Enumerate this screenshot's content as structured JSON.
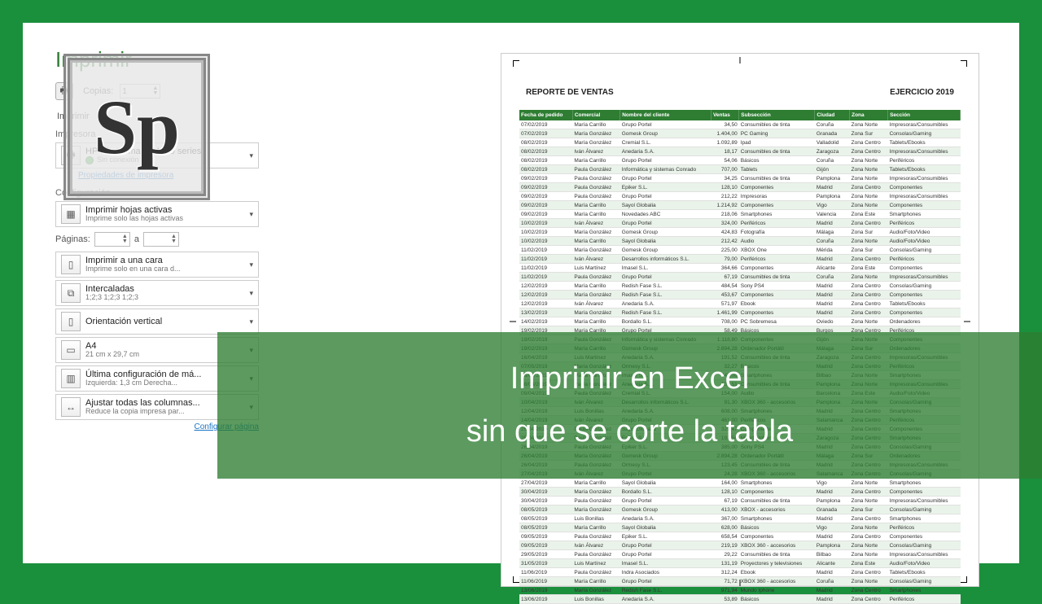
{
  "sidebar": {
    "title": "Imprimir",
    "copies_label": "Copias:",
    "copies_value": "1",
    "print_label": "Imprimir",
    "printer_section": "Impresora",
    "printer_name": "HP Photosmart C4400 series",
    "printer_status": "Sin conexión",
    "printer_props_link": "Propiedades de impresora",
    "config_section": "Configuración",
    "active_sheets": {
      "t1": "Imprimir hojas activas",
      "t2": "Imprime solo las hojas activas"
    },
    "pages_label": "Páginas:",
    "pages_to": "a",
    "one_side": {
      "t1": "Imprimir a una cara",
      "t2": "Imprime solo en una cara d..."
    },
    "collated": {
      "t1": "Intercaladas",
      "t2": "1;2;3   1;2;3   1;2;3"
    },
    "orientation": {
      "t1": "Orientación vertical",
      "t2": ""
    },
    "paper": {
      "t1": "A4",
      "t2": "21 cm x 29,7 cm"
    },
    "margins": {
      "t1": "Última configuración de má...",
      "t2": "Izquierda: 1,3 cm   Derecha..."
    },
    "scaling": {
      "t1": "Ajustar todas las columnas...",
      "t2": "Reduce la copia impresa par..."
    },
    "page_setup_link": "Configurar página"
  },
  "logo_text": "Sp",
  "overlay": {
    "line1": "Imprimir en Excel",
    "line2": "sin que se corte la tabla"
  },
  "report": {
    "title": "REPORTE DE VENTAS",
    "period": "EJERCICIO 2019",
    "columns": [
      "Fecha de pedido",
      "Comercial",
      "Nombre del cliente",
      "Ventas",
      "Subsección",
      "Ciudad",
      "Zona",
      "Sección"
    ],
    "rows": [
      [
        "07/02/2019",
        "María Carrillo",
        "Grupo Portel",
        "34,50",
        "Consumibles de tinta",
        "Coruña",
        "Zona Norte",
        "Impresoras/Consumibles"
      ],
      [
        "07/02/2019",
        "María González",
        "Gomesk Group",
        "1.404,00",
        "PC Gaming",
        "Granada",
        "Zona Sur",
        "Consolas/Gaming"
      ],
      [
        "08/02/2019",
        "María González",
        "Cremial S.L.",
        "1.092,89",
        "Ipad",
        "Valladolid",
        "Zona Centro",
        "Tablets/Ebooks"
      ],
      [
        "08/02/2019",
        "Iván Álvarez",
        "Anedaria S.A.",
        "18,17",
        "Consumibles de tinta",
        "Zaragoza",
        "Zona Centro",
        "Impresoras/Consumibles"
      ],
      [
        "08/02/2019",
        "María Carrillo",
        "Grupo Portel",
        "54,06",
        "Básicos",
        "Coruña",
        "Zona Norte",
        "Periféricos"
      ],
      [
        "08/02/2019",
        "Paula González",
        "Informática y sistemas Conrado",
        "707,00",
        "Tablets",
        "Gijón",
        "Zona Norte",
        "Tablets/Ebooks"
      ],
      [
        "09/02/2019",
        "Paula González",
        "Grupo Portel",
        "34,25",
        "Consumibles de tinta",
        "Pamplona",
        "Zona Norte",
        "Impresoras/Consumibles"
      ],
      [
        "09/02/2019",
        "Paula González",
        "Epiker S.L.",
        "128,10",
        "Componentes",
        "Madrid",
        "Zona Centro",
        "Componentes"
      ],
      [
        "09/02/2019",
        "Paula González",
        "Grupo Portel",
        "212,22",
        "Impresoras",
        "Pamplona",
        "Zona Norte",
        "Impresoras/Consumibles"
      ],
      [
        "09/02/2019",
        "María Carrillo",
        "Sayol Globalia",
        "1.214,92",
        "Componentes",
        "Vigo",
        "Zona Norte",
        "Componentes"
      ],
      [
        "09/02/2019",
        "María Carrillo",
        "Novedades ABC",
        "218,06",
        "Smartphones",
        "Valencia",
        "Zona Este",
        "Smartphones"
      ],
      [
        "10/02/2019",
        "Iván Álvarez",
        "Grupo Portel",
        "324,00",
        "Periféricos",
        "Madrid",
        "Zona Centro",
        "Periféricos"
      ],
      [
        "10/02/2019",
        "María González",
        "Gomesk Group",
        "424,83",
        "Fotografía",
        "Málaga",
        "Zona Sur",
        "Audio/Foto/Video"
      ],
      [
        "10/02/2019",
        "María Carrillo",
        "Sayol Globalia",
        "212,42",
        "Audio",
        "Coruña",
        "Zona Norte",
        "Audio/Foto/Video"
      ],
      [
        "11/02/2019",
        "María González",
        "Gomesk Group",
        "225,00",
        "XBOX One",
        "Mérida",
        "Zona Sur",
        "Consolas/Gaming"
      ],
      [
        "11/02/2019",
        "Iván Álvarez",
        "Desarrollos informáticos S.L.",
        "79,00",
        "Periféricos",
        "Madrid",
        "Zona Centro",
        "Periféricos"
      ],
      [
        "11/02/2019",
        "Luis Martínez",
        "Imasel S.L.",
        "364,66",
        "Componentes",
        "Alicante",
        "Zona Este",
        "Componentes"
      ],
      [
        "11/02/2019",
        "Paula González",
        "Grupo Portel",
        "67,19",
        "Consumibles de tinta",
        "Coruña",
        "Zona Norte",
        "Impresoras/Consumibles"
      ],
      [
        "12/02/2019",
        "María Carrillo",
        "Redish Fase S.L.",
        "484,54",
        "Sony PS4",
        "Madrid",
        "Zona Centro",
        "Consolas/Gaming"
      ],
      [
        "12/02/2019",
        "María González",
        "Redish Fase S.L.",
        "453,67",
        "Componentes",
        "Madrid",
        "Zona Centro",
        "Componentes"
      ],
      [
        "12/02/2019",
        "Iván Álvarez",
        "Anedaria S.A.",
        "571,97",
        "Ebook",
        "Madrid",
        "Zona Centro",
        "Tablets/Ebooks"
      ],
      [
        "13/02/2019",
        "María González",
        "Redish Fase S.L.",
        "1.461,99",
        "Componentes",
        "Madrid",
        "Zona Centro",
        "Componentes"
      ],
      [
        "14/02/2019",
        "María Carrillo",
        "Bordallo S.L.",
        "708,00",
        "PC Sobremesa",
        "Oviedo",
        "Zona Norte",
        "Ordenadores"
      ],
      [
        "19/02/2019",
        "María Carrillo",
        "Grupo Portel",
        "58,49",
        "Básicos",
        "Burgos",
        "Zona Centro",
        "Periféricos"
      ],
      [
        "19/02/2019",
        "Paula González",
        "Informática y sistemas Conrado",
        "1.118,80",
        "Componentes",
        "Gijón",
        "Zona Norte",
        "Componentes"
      ],
      [
        "19/02/2019",
        "María Carrillo",
        "Gomesk Group",
        "2.894,28",
        "Ordenador Portátil",
        "Málaga",
        "Zona Sur",
        "Ordenadores"
      ],
      [
        "16/04/2019",
        "Luis Martínez",
        "Anedaria S.A.",
        "191,52",
        "Consumibles de tinta",
        "Zaragoza",
        "Zona Centro",
        "Impresoras/Consumibles"
      ],
      [
        "07/05/2019",
        "María González",
        "Ormesy S.L.",
        "32,27",
        "Básicos",
        "Madrid",
        "Zona Centro",
        "Periféricos"
      ],
      [
        "08/04/2019",
        "María Carrillo",
        "Imasel S.L.",
        "248,06",
        "Smartphones",
        "Bilbao",
        "Zona Norte",
        "Smartphones"
      ],
      [
        "08/04/2019",
        "Paula González",
        "Anedaria S.A.",
        "102,51",
        "Consumibles de tinta",
        "Pamplona",
        "Zona Norte",
        "Impresoras/Consumibles"
      ],
      [
        "09/04/2019",
        "Paula González",
        "Cremial S.L.",
        "154,00",
        "Audio",
        "Barcelona",
        "Zona Este",
        "Audio/Foto/Video"
      ],
      [
        "10/04/2019",
        "Iván Álvarez",
        "Desarrollos informáticos S.L.",
        "91,30",
        "XBOX 360 - accesorios",
        "Pamplona",
        "Zona Norte",
        "Consolas/Gaming"
      ],
      [
        "12/04/2019",
        "Luis Bonillas",
        "Anedaria S.A.",
        "608,00",
        "Smartphones",
        "Madrid",
        "Zona Centro",
        "Smartphones"
      ],
      [
        "14/04/2019",
        "Iván Álvarez",
        "Grupo Portel",
        "461,00",
        "Periféricos",
        "Salamanca",
        "Zona Centro",
        "Periféricos"
      ],
      [
        "25/04/2019",
        "Paula González",
        "Sayol Globalia",
        "329,47",
        "Componentes",
        "Madrid",
        "Zona Centro",
        "Componentes"
      ],
      [
        "25/04/2019",
        "Paula González",
        "Epiker S.L.",
        "191,54",
        "Mundo Iphone",
        "Zaragoza",
        "Zona Centro",
        "Smartphones"
      ],
      [
        "26/04/2019",
        "Paula González",
        "Epiker S.L.",
        "385,00",
        "Sony PS4",
        "Madrid",
        "Zona Centro",
        "Consolas/Gaming"
      ],
      [
        "26/04/2019",
        "María González",
        "Gomesk Group",
        "2.894,28",
        "Ordenador Portátil",
        "Málaga",
        "Zona Sur",
        "Ordenadores"
      ],
      [
        "26/04/2019",
        "Paula González",
        "Ormesy S.L.",
        "123,45",
        "Consumibles de tinta",
        "Madrid",
        "Zona Centro",
        "Impresoras/Consumibles"
      ],
      [
        "27/04/2019",
        "Iván Álvarez",
        "Grupo Portel",
        "24,28",
        "XBOX 360 - accesorios",
        "Salamanca",
        "Zona Centro",
        "Consolas/Gaming"
      ],
      [
        "27/04/2019",
        "María Carrillo",
        "Sayol Globalia",
        "164,00",
        "Smartphones",
        "Vigo",
        "Zona Norte",
        "Smartphones"
      ],
      [
        "30/04/2019",
        "María González",
        "Bordallo S.L.",
        "128,10",
        "Componentes",
        "Madrid",
        "Zona Centro",
        "Componentes"
      ],
      [
        "30/04/2019",
        "Paula González",
        "Grupo Portel",
        "67,19",
        "Consumibles de tinta",
        "Pamplona",
        "Zona Norte",
        "Impresoras/Consumibles"
      ],
      [
        "08/05/2019",
        "María González",
        "Gomesk Group",
        "413,00",
        "XBOX - accesorios",
        "Granada",
        "Zona Sur",
        "Consolas/Gaming"
      ],
      [
        "08/05/2019",
        "Luis Bonillas",
        "Anedaria S.A.",
        "367,00",
        "Smartphones",
        "Madrid",
        "Zona Centro",
        "Smartphones"
      ],
      [
        "08/05/2019",
        "María Carrillo",
        "Sayol Globalia",
        "628,00",
        "Básicos",
        "Vigo",
        "Zona Norte",
        "Periféricos"
      ],
      [
        "09/05/2019",
        "Paula González",
        "Epiker S.L.",
        "658,54",
        "Componentes",
        "Madrid",
        "Zona Centro",
        "Componentes"
      ],
      [
        "09/05/2019",
        "Iván Álvarez",
        "Grupo Portel",
        "219,19",
        "XBOX 360 - accesorios",
        "Pamplona",
        "Zona Norte",
        "Consolas/Gaming"
      ],
      [
        "29/05/2019",
        "Paula González",
        "Grupo Portel",
        "29,22",
        "Consumibles de tinta",
        "Bilbao",
        "Zona Norte",
        "Impresoras/Consumibles"
      ],
      [
        "31/05/2019",
        "Luis Martínez",
        "Imasel S.L.",
        "131,19",
        "Proyectores y televisiones",
        "Alicante",
        "Zona Este",
        "Audio/Foto/Video"
      ],
      [
        "11/06/2019",
        "Paula González",
        "Indra Asociados",
        "312,24",
        "Ebook",
        "Madrid",
        "Zona Centro",
        "Tablets/Ebooks"
      ],
      [
        "11/06/2019",
        "María Carrillo",
        "Grupo Portel",
        "71,72",
        "XBOX 360 - accesorios",
        "Coruña",
        "Zona Norte",
        "Consolas/Gaming"
      ],
      [
        "13/06/2019",
        "María González",
        "Redish Fase S.L.",
        "971,94",
        "Mundo Iphone",
        "Madrid",
        "Zona Centro",
        "Smartphones"
      ],
      [
        "13/06/2019",
        "Luis Bonillas",
        "Anedaria S.A.",
        "53,89",
        "Básicos",
        "Madrid",
        "Zona Centro",
        "Periféricos"
      ]
    ]
  }
}
